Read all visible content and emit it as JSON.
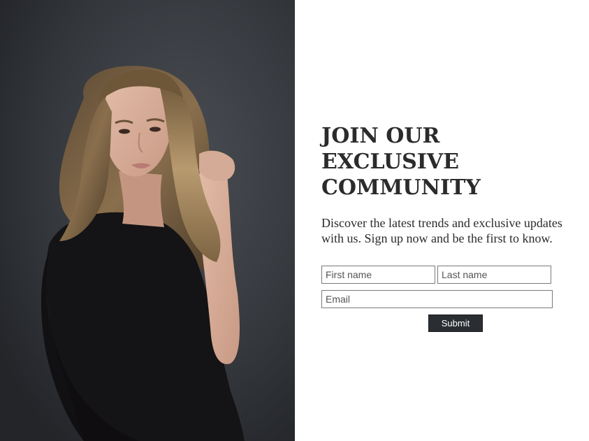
{
  "hero_image": {
    "icon": "portrait-photo",
    "background_color": "#3a3d42"
  },
  "signup": {
    "headline_lines": [
      "JOIN OUR",
      "EXCLUSIVE",
      "COMMUNITY"
    ],
    "description_lines": [
      "Discover the latest trends and exclusive updates",
      "with us. Sign up now and be the first to know."
    ],
    "first_name_placeholder": "First name",
    "last_name_placeholder": "Last name",
    "email_placeholder": "Email",
    "submit_label": "Submit"
  },
  "colors": {
    "text": "#2b2b2b",
    "button_bg": "#2a2d31",
    "button_text": "#ffffff",
    "field_border": "#7a7a7a"
  }
}
